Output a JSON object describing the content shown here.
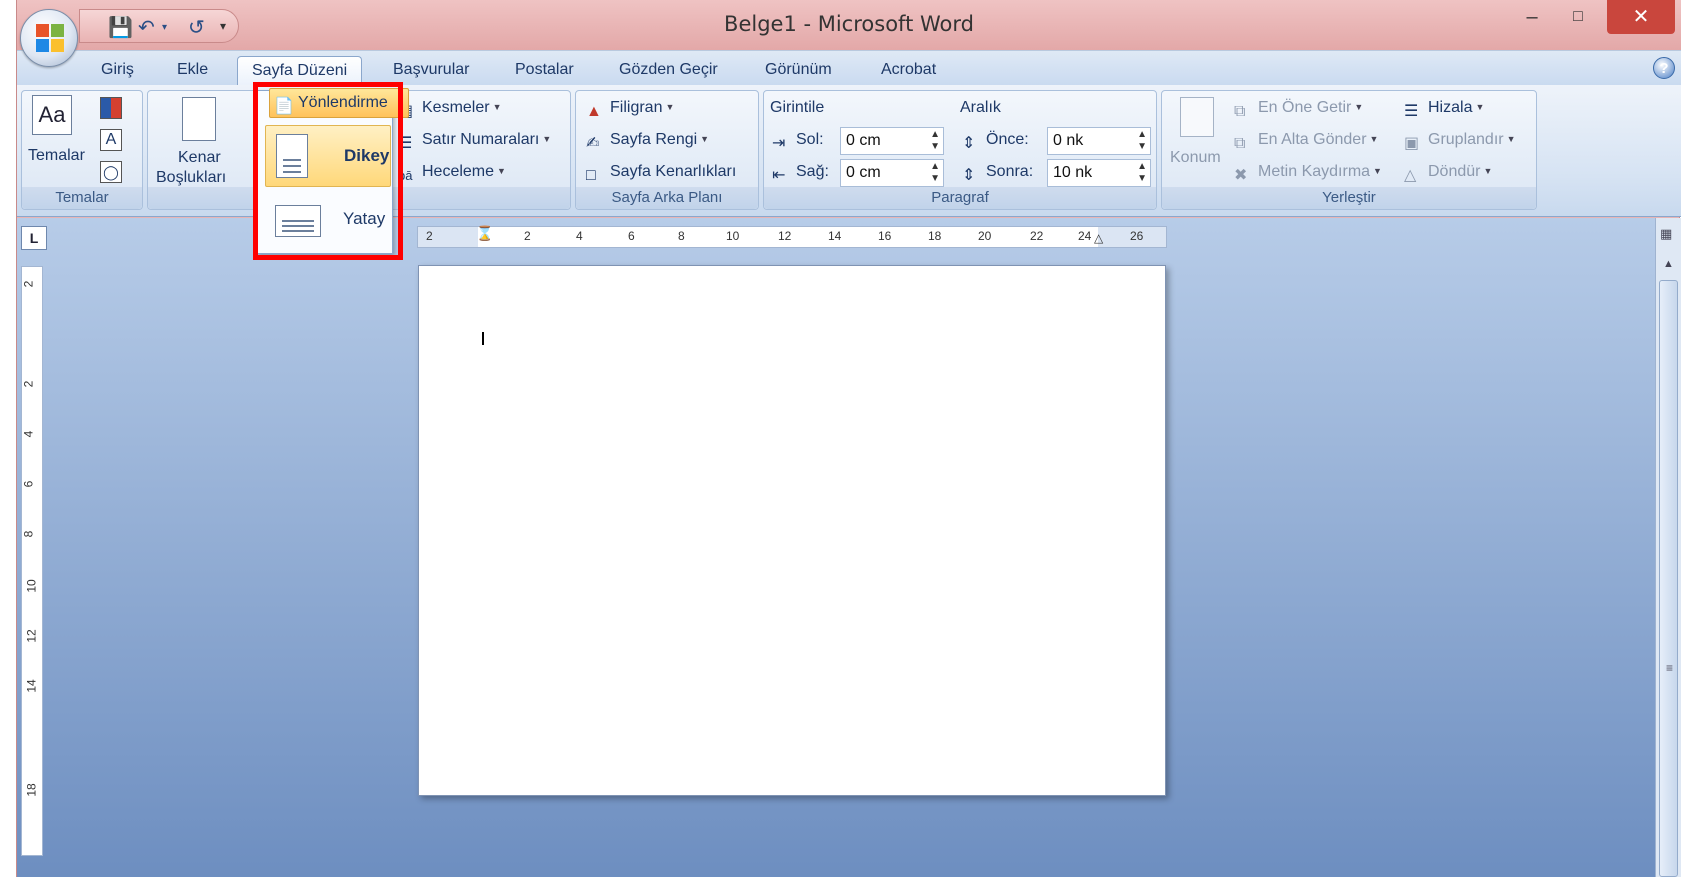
{
  "window": {
    "title": "Belge1 - Microsoft Word"
  },
  "tabs": [
    "Giriş",
    "Ekle",
    "Sayfa Düzeni",
    "Başvurular",
    "Postalar",
    "Gözden Geçir",
    "Görünüm",
    "Acrobat"
  ],
  "active_tab": "Sayfa Düzeni",
  "groups": {
    "temalar": {
      "label": "Temalar",
      "button": "Temalar"
    },
    "sayfa_yapisi": {
      "kenar": "Kenar",
      "bosluklari": "Boşlukları",
      "yonlendirme": "Yönlendirme",
      "kesmeler": "Kesmeler",
      "satir_numaralari": "Satır Numaraları",
      "heceleme": "Heceleme"
    },
    "sayfa_arka_plani": {
      "label": "Sayfa Arka Planı",
      "filigran": "Filigran",
      "sayfa_rengi": "Sayfa Rengi",
      "sayfa_kenarliklari": "Sayfa Kenarlıkları"
    },
    "paragraf": {
      "label": "Paragraf",
      "girintile": "Girintile",
      "sol_label": "Sol:",
      "sol_value": "0 cm",
      "sag_label": "Sağ:",
      "sag_value": "0 cm",
      "aralik": "Aralık",
      "once_label": "Önce:",
      "once_value": "0 nk",
      "sonra_label": "Sonra:",
      "sonra_value": "10 nk"
    },
    "yerlestir": {
      "label": "Yerleştir",
      "konum": "Konum",
      "en_one_getir": "En Öne Getir",
      "en_alta_gonder": "En Alta Gönder",
      "metin_kaydirma": "Metin Kaydırma",
      "hizala": "Hizala",
      "gruplandir": "Gruplandır",
      "dondur": "Döndür"
    }
  },
  "orientation_menu": {
    "dikey": "Dikey",
    "yatay": "Yatay"
  },
  "ruler": {
    "horizontal": [
      "2",
      "2",
      "4",
      "6",
      "8",
      "10",
      "12",
      "14",
      "16",
      "18",
      "20",
      "22",
      "24",
      "26"
    ],
    "vertical": [
      "2",
      "2",
      "4",
      "6",
      "8",
      "10",
      "12",
      "14",
      "18"
    ]
  },
  "colors": {
    "highlight": "#ff0000",
    "titlebar": "#e8b4b4",
    "ribbon": "#dbe6f4"
  }
}
